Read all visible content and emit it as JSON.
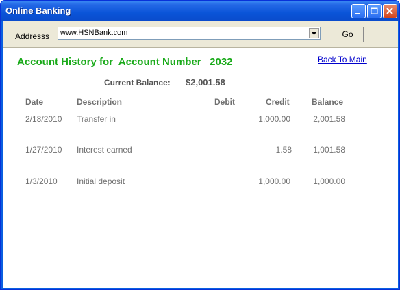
{
  "window": {
    "title": "Online Banking"
  },
  "toolbar": {
    "address_label": "Addresss",
    "address_value": "www.HSNBank.com",
    "go_label": "Go"
  },
  "page": {
    "heading": "Account History for  Account Number   2032",
    "back_link": "Back To Main",
    "balance_label": "Current Balance:",
    "balance_value": "$2,001.58"
  },
  "table": {
    "headers": {
      "date": "Date",
      "description": "Description",
      "debit": "Debit",
      "credit": "Credit",
      "balance": "Balance"
    },
    "rows": [
      {
        "date": "2/18/2010",
        "description": "Transfer in",
        "debit": "",
        "credit": "1,000.00",
        "balance": "2,001.58"
      },
      {
        "date": "1/27/2010",
        "description": "Interest earned",
        "debit": "",
        "credit": "1.58",
        "balance": "1,001.58"
      },
      {
        "date": "1/3/2010",
        "description": "Initial deposit",
        "debit": "",
        "credit": "1,000.00",
        "balance": "1,000.00"
      }
    ]
  }
}
